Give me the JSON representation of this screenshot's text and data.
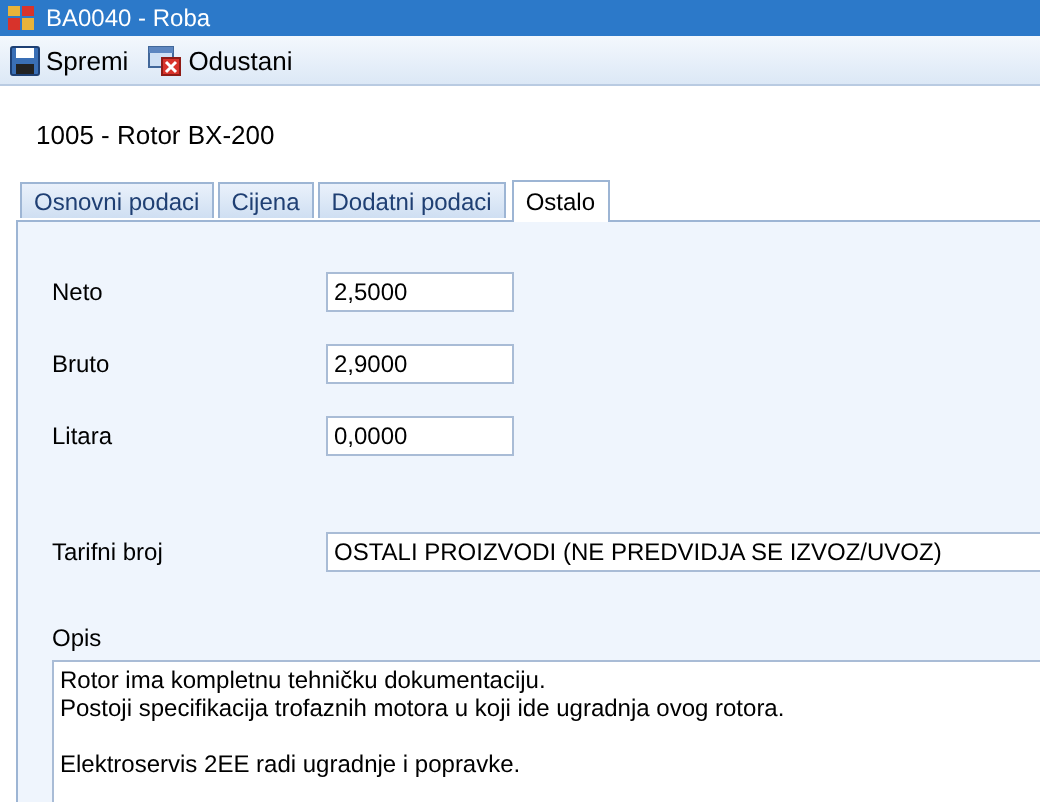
{
  "window": {
    "title": "BA0040 - Roba"
  },
  "toolbar": [
    {
      "kind": "save",
      "label": "Spremi"
    },
    {
      "kind": "cancel",
      "label": "Odustani"
    }
  ],
  "heading": "1005 - Rotor BX-200",
  "tabs": [
    {
      "label": "Osnovni podaci",
      "selected": false
    },
    {
      "label": "Cijena",
      "selected": false
    },
    {
      "label": "Dodatni podaci",
      "selected": false
    },
    {
      "label": "Ostalo",
      "selected": true
    }
  ],
  "fields": [
    {
      "kind": "short",
      "label": "Neto",
      "value": "2,5000"
    },
    {
      "kind": "short",
      "label": "Bruto",
      "value": "2,9000"
    },
    {
      "kind": "short",
      "label": "Litara",
      "value": "0,0000"
    },
    {
      "kind": "wide",
      "label": "Tarifni broj",
      "value": "OSTALI PROIZVODI (NE PREDVIDJA SE IZVOZ/UVOZ)"
    }
  ],
  "description": {
    "label": "Opis",
    "value": "Rotor ima kompletnu tehničku dokumentaciju.\nPostoji specifikacija trofaznih motora u koji ide ugradnja ovog rotora.\n\nElektroservis 2EE radi ugradnje i popravke."
  }
}
